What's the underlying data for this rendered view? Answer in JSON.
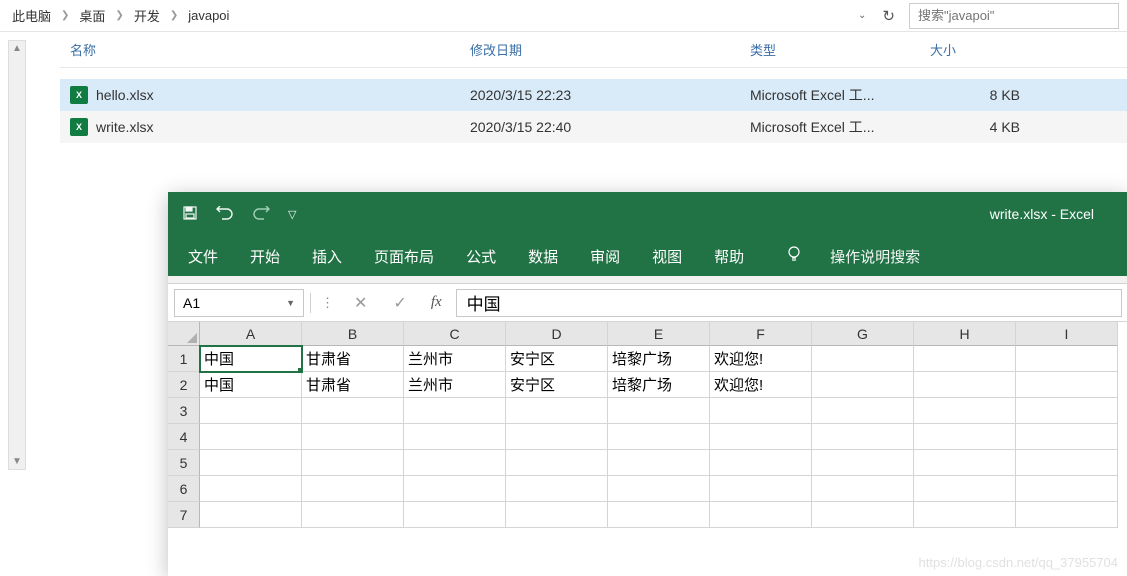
{
  "explorer": {
    "breadcrumb": [
      "此电脑",
      "桌面",
      "开发",
      "javapoi"
    ],
    "search_placeholder": "搜索\"javapoi\"",
    "columns": {
      "name": "名称",
      "date": "修改日期",
      "type": "类型",
      "size": "大小"
    },
    "files": [
      {
        "name": "hello.xlsx",
        "date": "2020/3/15 22:23",
        "type": "Microsoft Excel 工...",
        "size": "8 KB"
      },
      {
        "name": "write.xlsx",
        "date": "2020/3/15 22:40",
        "type": "Microsoft Excel 工...",
        "size": "4 KB"
      }
    ]
  },
  "excel": {
    "title": "write.xlsx  -  Excel",
    "tabs": [
      "文件",
      "开始",
      "插入",
      "页面布局",
      "公式",
      "数据",
      "审阅",
      "视图",
      "帮助"
    ],
    "tell_me": "操作说明搜索",
    "name_box": "A1",
    "formula_value": "中国",
    "columns": [
      "A",
      "B",
      "C",
      "D",
      "E",
      "F",
      "G",
      "H",
      "I"
    ],
    "row_count": 7,
    "data": [
      [
        "中国",
        "甘肃省",
        "兰州市",
        "安宁区",
        "培黎广场",
        "欢迎您!",
        "",
        "",
        ""
      ],
      [
        "中国",
        "甘肃省",
        "兰州市",
        "安宁区",
        "培黎广场",
        "欢迎您!",
        "",
        "",
        ""
      ]
    ],
    "active_cell": {
      "row": 0,
      "col": 0
    }
  },
  "watermark": "https://blog.csdn.net/qq_37955704"
}
